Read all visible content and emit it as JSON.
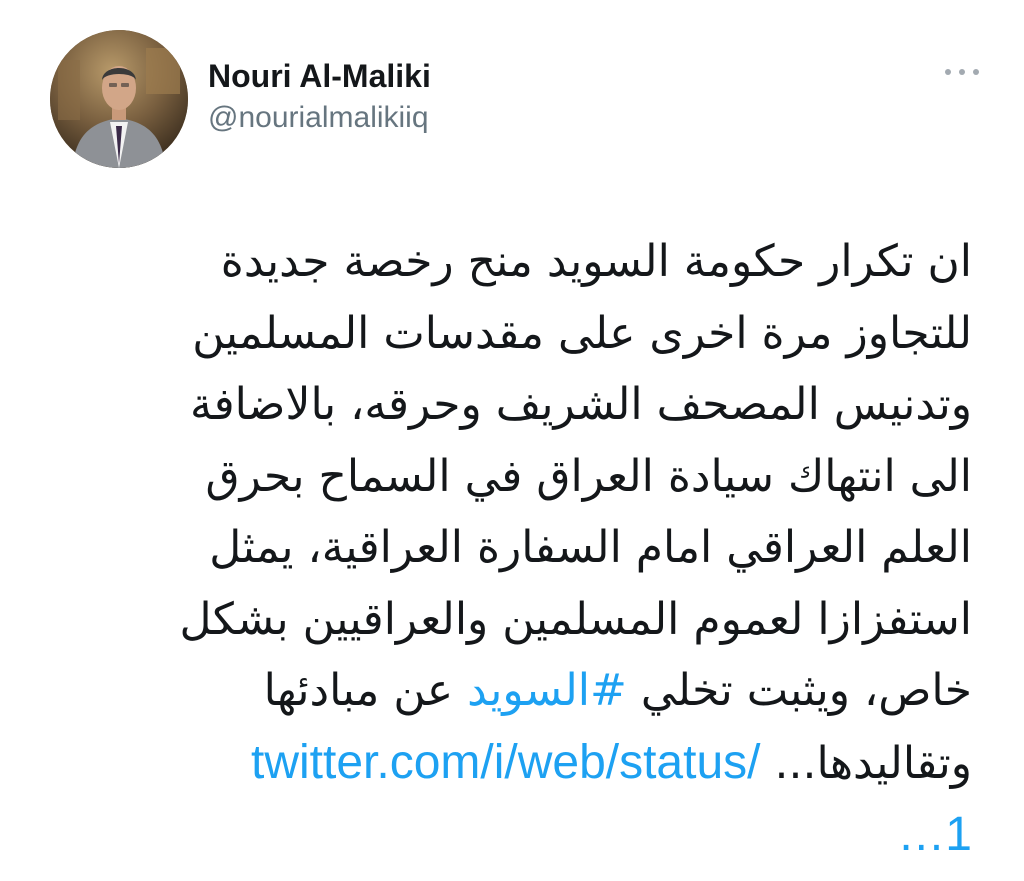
{
  "author": {
    "display_name": "Nouri Al-Maliki",
    "handle": "@nourialmalikiiq",
    "avatar_icon": "profile-photo"
  },
  "actions": {
    "more_icon": "ellipsis-icon"
  },
  "tweet": {
    "lines": [
      "ان تكرار حكومة السويد منح رخصة جديدة",
      "للتجاوز مرة اخرى على مقدسات المسلمين",
      "وتدنيس المصحف الشريف وحرقه، بالاضافة",
      "الى انتهاك سيادة العراق في السماح بحرق",
      "العلم العراقي امام السفارة العراقية، يمثل",
      "استفزازا لعموم المسلمين والعراقيين بشكل"
    ],
    "line7_before": "خاص، ويثبت تخلي ",
    "hashtag": "#السويد",
    "line7_after": " عن مبادئها",
    "line8_text": "وتقاليدها... ",
    "link": "twitter.com/i/web/status/",
    "link_continuation": "1…"
  },
  "colors": {
    "link": "#1da1f2",
    "text": "#14171a",
    "secondary": "#66757f"
  }
}
